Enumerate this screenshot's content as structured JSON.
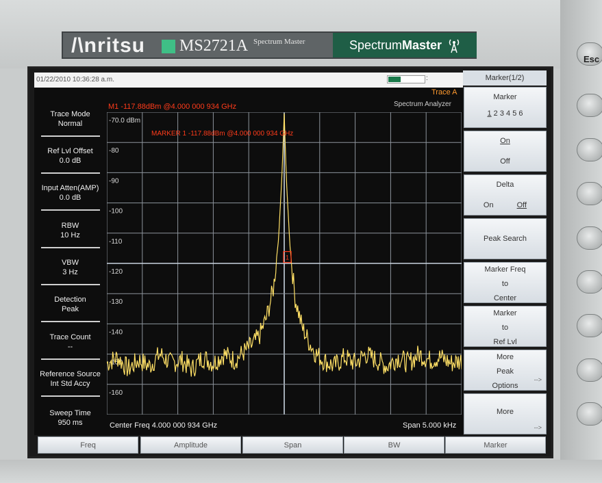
{
  "device": {
    "brand": "/\\nritsu",
    "model": "MS2721A",
    "model_subtitle": "Spectrum Master",
    "product_name_light": "Spectrum",
    "product_name_bold": "Master",
    "esc_label": "Esc"
  },
  "status": {
    "datetime": "01/22/2010 10:36:28 a.m.",
    "battery_level": 0.35,
    "battery_suffix": ":"
  },
  "left_panel": [
    {
      "label": "Trace Mode",
      "value": "Normal"
    },
    {
      "label": "Ref Lvl Offset",
      "value": "0.0 dB"
    },
    {
      "label": "Input Atten(AMP)",
      "value": "0.0 dB"
    },
    {
      "label": "RBW",
      "value": "10 Hz"
    },
    {
      "label": "VBW",
      "value": "3 Hz"
    },
    {
      "label": "Detection",
      "value": "Peak"
    },
    {
      "label": "Trace Count",
      "value": "--"
    },
    {
      "label": "Reference Source",
      "value": "Int Std Accy"
    },
    {
      "label": "Sweep Time",
      "value": "950 ms"
    }
  ],
  "plot": {
    "marker_readout": "M1 -117.88dBm @4.000 000 934 GHz",
    "marker_annotation": "MARKER 1 -117.88dBm @4.000 000 934 GHz",
    "trace_label": "Trace A",
    "mode_label": "Spectrum Analyzer",
    "center_freq": "Center Freq 4.000 000 934 GHz",
    "span": "Span 5.000 kHz",
    "marker_box_label": "1",
    "colors": {
      "trace": "#ffe066",
      "grid": "#8d949c",
      "marker": "#ff3b1a"
    }
  },
  "chart_data": {
    "type": "line",
    "ylabel": "",
    "yticks": [
      "-70.0 dBm",
      "-80",
      "-90",
      "-100",
      "-110",
      "-120",
      "-130",
      "-140",
      "-150",
      "-160"
    ],
    "ylim": [
      -170,
      -70
    ],
    "x_center_ghz": 4.000000934,
    "span_khz": 5.0,
    "xlim_khz_offset": [
      -2.5,
      2.5
    ],
    "grid": true,
    "noise_floor_dbm": -153,
    "peak": {
      "x_khz_offset": 0.0,
      "y_dbm": -70.5
    },
    "marker": {
      "x_khz_offset": 0.0,
      "y_dbm": -117.88
    },
    "series": [
      {
        "x_khz_offset": [
          -2.5,
          -2.35,
          -2.2,
          -2.05,
          -1.9,
          -1.75,
          -1.6,
          -1.45,
          -1.3,
          -1.15,
          -1.0,
          -0.85,
          -0.7,
          -0.55,
          -0.45,
          -0.35,
          -0.25,
          -0.15,
          -0.08,
          -0.03,
          0.0,
          0.03,
          0.08,
          0.15,
          0.25,
          0.35,
          0.45,
          0.55,
          0.7,
          0.85,
          1.0,
          1.15,
          1.3,
          1.45,
          1.6,
          1.75,
          1.9,
          2.05,
          2.2,
          2.35,
          2.5
        ],
        "values": [
          -153,
          -151,
          -155,
          -152,
          -154,
          -150,
          -153,
          -152,
          -155,
          -151,
          -153,
          -150,
          -152,
          -149,
          -147,
          -144,
          -138,
          -128,
          -112,
          -90,
          -70.5,
          -92,
          -114,
          -131,
          -141,
          -146,
          -150,
          -152,
          -154,
          -151,
          -153,
          -150,
          -152,
          -154,
          -151,
          -153,
          -150,
          -152,
          -151,
          -153,
          -152
        ]
      }
    ]
  },
  "softkeys": {
    "title": "Marker(1/2)",
    "marker_label": "Marker",
    "marker_active": "1",
    "marker_rest": " 2 3 4 5 6",
    "on_label": "On",
    "off_label": "Off",
    "delta_label": "Delta",
    "delta_on": "On",
    "delta_off": "Off",
    "peak_search": "Peak Search",
    "freq_to_center_1": "Marker Freq",
    "freq_to_center_2": "to",
    "freq_to_center_3": "Center",
    "to_ref_1": "Marker",
    "to_ref_2": "to",
    "to_ref_3": "Ref Lvl",
    "more_peak_1": "More",
    "more_peak_2": "Peak",
    "more_peak_3": "Options",
    "more_label": "More",
    "arrow": "-->"
  },
  "tabs": [
    "Freq",
    "Amplitude",
    "Span",
    "BW",
    "Marker"
  ]
}
